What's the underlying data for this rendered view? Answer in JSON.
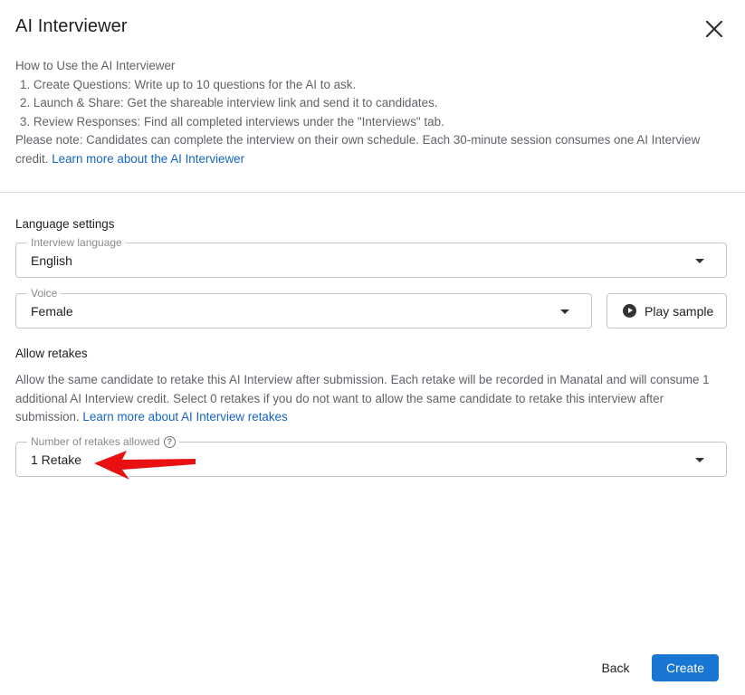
{
  "dialog": {
    "title": "AI Interviewer"
  },
  "intro": {
    "heading": "How to Use the AI Interviewer",
    "steps": [
      "1. Create Questions: Write up to 10 questions for the AI to ask.",
      "2. Launch & Share: Get the shareable interview link and send it to candidates.",
      "3. Review Responses: Find all completed interviews under the \"Interviews\" tab."
    ],
    "note": "Please note: Candidates can complete the interview on their own schedule. Each 30-minute session consumes one AI Interview credit. ",
    "learn_more_link": "Learn more about the AI Interviewer"
  },
  "language_settings": {
    "heading": "Language settings",
    "interview_language": {
      "label": "Interview language",
      "value": "English"
    },
    "voice": {
      "label": "Voice",
      "value": "Female"
    },
    "play_sample_label": "Play sample"
  },
  "retakes": {
    "heading": "Allow retakes",
    "description": "Allow the same candidate to retake this AI Interview after submission. Each retake will be recorded in Manatal and will consume 1 additional AI Interview credit. Select 0 retakes if you do not want to allow the same candidate to retake this interview after submission. ",
    "learn_more_link": "Learn more about AI Interview retakes",
    "number_field": {
      "label": "Number of retakes allowed",
      "help_glyph": "?",
      "value": "1 Retake"
    }
  },
  "annotation": {
    "arrow_color": "#e81010"
  },
  "footer": {
    "back_label": "Back",
    "create_label": "Create"
  },
  "colors": {
    "primary": "#1976d2",
    "link": "#1565c0"
  }
}
